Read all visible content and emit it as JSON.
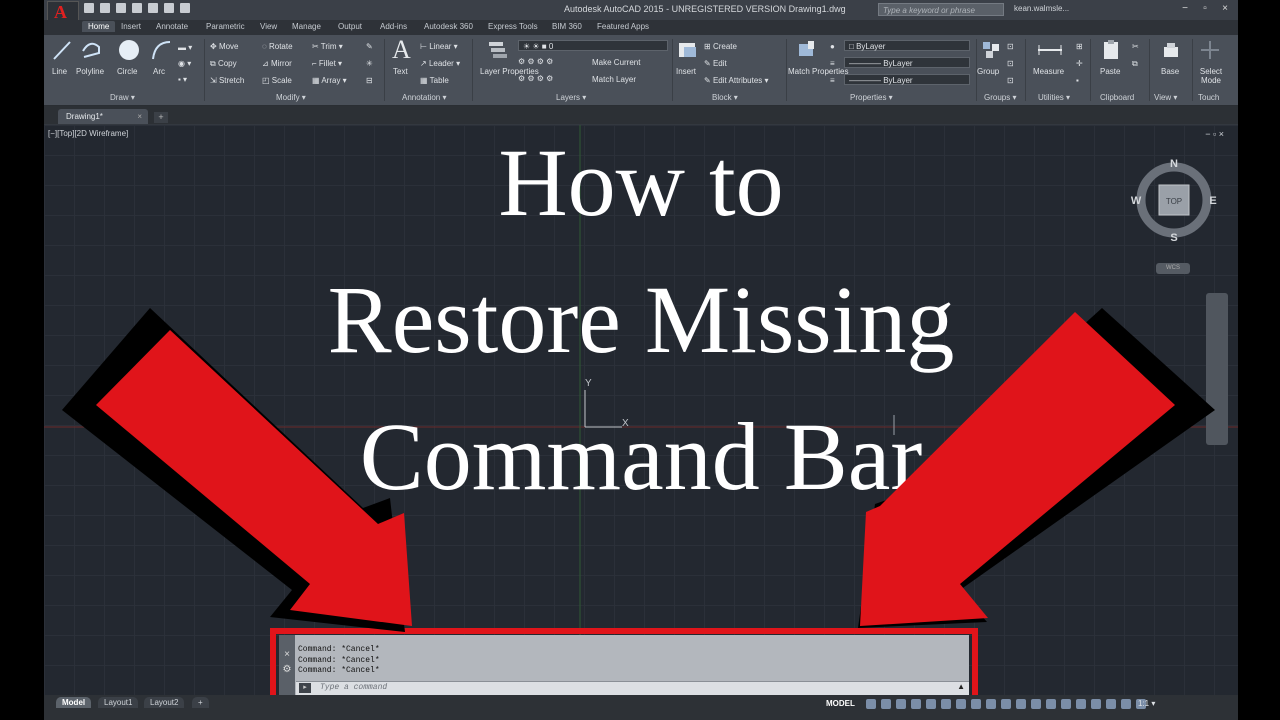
{
  "app": {
    "title": "Autodesk AutoCAD 2015 - UNREGISTERED VERSION    Drawing1.dwg",
    "search_placeholder": "Type a keyword or phrase",
    "user": "kean.walmsle...",
    "logo_letter": "A"
  },
  "ribbon_tabs": [
    "Home",
    "Insert",
    "Annotate",
    "Parametric",
    "View",
    "Manage",
    "Output",
    "Add-ins",
    "Autodesk 360",
    "Express Tools",
    "BIM 360",
    "Featured Apps"
  ],
  "ribbon": {
    "draw": {
      "line": "Line",
      "polyline": "Polyline",
      "circle": "Circle",
      "arc": "Arc",
      "panel": "Draw ▾"
    },
    "modify": {
      "move": "Move",
      "rotate": "Rotate",
      "trim": "Trim ▾",
      "copy": "Copy",
      "mirror": "Mirror",
      "fillet": "Fillet ▾",
      "stretch": "Stretch",
      "scale": "Scale",
      "array": "Array ▾",
      "panel": "Modify ▾"
    },
    "annotation": {
      "text": "Text",
      "linear": "Linear ▾",
      "leader": "Leader ▾",
      "table": "Table",
      "panel": "Annotation ▾"
    },
    "layers": {
      "layer_props": "Layer Properties",
      "make_current": "Make Current",
      "match_layer": "Match Layer",
      "current_layer": "0",
      "panel": "Layers ▾"
    },
    "block": {
      "insert": "Insert",
      "create": "Create",
      "edit": "Edit",
      "edit_attr": "Edit Attributes ▾",
      "panel": "Block ▾"
    },
    "properties": {
      "match": "Match Properties",
      "bylayer1": "ByLayer",
      "bylayer2": "———— ByLayer",
      "bylayer3": "———— ByLayer",
      "panel": "Properties ▾"
    },
    "groups": {
      "group": "Group",
      "panel": "Groups ▾"
    },
    "utilities": {
      "measure": "Measure",
      "panel": "Utilities ▾"
    },
    "clipboard": {
      "paste": "Paste",
      "panel": "Clipboard"
    },
    "view": {
      "base": "Base",
      "panel": "View ▾"
    },
    "touch": {
      "select_mode": "Select Mode",
      "panel": "Touch"
    }
  },
  "file_tab": {
    "name": "Drawing1*",
    "close": "×",
    "plus": "+"
  },
  "viewport": {
    "controls": "[−][Top][2D Wireframe]",
    "buttons": "− ▫ ×"
  },
  "headline": [
    "How to",
    "Restore Missing",
    "Command Bar"
  ],
  "viewcube": {
    "n": "N",
    "s": "S",
    "e": "E",
    "w": "W",
    "face": "TOP",
    "wcs": "WCS"
  },
  "ucs": {
    "x": "X",
    "y": "Y"
  },
  "command": {
    "history": [
      "Command: *Cancel*",
      "Command: *Cancel*",
      "Command: *Cancel*"
    ],
    "placeholder": "Type a command"
  },
  "layout_tabs": [
    "Model",
    "Layout1",
    "Layout2"
  ],
  "status": {
    "model": "MODEL",
    "scale": "1:1 ▾"
  },
  "colors": {
    "arrow": "#e0141a",
    "highlight": "#e0141a",
    "canvas": "#232830"
  }
}
